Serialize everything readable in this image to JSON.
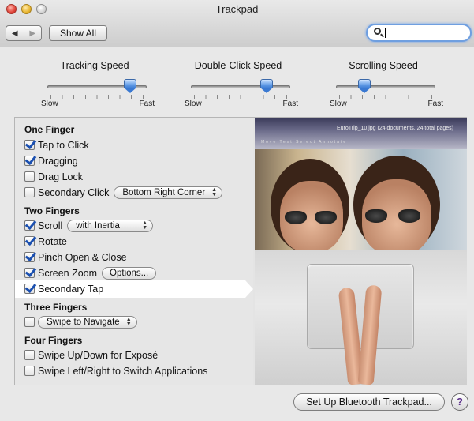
{
  "window": {
    "title": "Trackpad",
    "nav": {
      "back": "◀",
      "forward": "▶"
    },
    "show_all": "Show All",
    "search": {
      "value": "",
      "placeholder": ""
    }
  },
  "sliders": [
    {
      "title": "Tracking Speed",
      "min_label": "Slow",
      "max_label": "Fast",
      "value_fraction": 0.88
    },
    {
      "title": "Double-Click Speed",
      "min_label": "Slow",
      "max_label": "Fast",
      "value_fraction": 0.8
    },
    {
      "title": "Scrolling Speed",
      "min_label": "Slow",
      "max_label": "Fast",
      "value_fraction": 0.25
    }
  ],
  "sections": {
    "one_finger": "One Finger",
    "two_fingers": "Two Fingers",
    "three_fingers": "Three Fingers",
    "four_fingers": "Four Fingers"
  },
  "options": {
    "tap_to_click": {
      "label": "Tap to Click",
      "checked": true
    },
    "dragging": {
      "label": "Dragging",
      "checked": true
    },
    "drag_lock": {
      "label": "Drag Lock",
      "checked": false
    },
    "secondary_click": {
      "label": "Secondary Click",
      "checked": false,
      "popup": "Bottom Right Corner"
    },
    "scroll": {
      "label": "Scroll",
      "checked": true,
      "popup": "with Inertia"
    },
    "rotate": {
      "label": "Rotate",
      "checked": true
    },
    "pinch": {
      "label": "Pinch Open & Close",
      "checked": true
    },
    "screen_zoom": {
      "label": "Screen Zoom",
      "checked": true,
      "button": "Options..."
    },
    "secondary_tap": {
      "label": "Secondary Tap",
      "checked": true
    },
    "three_finger": {
      "checked": false,
      "popup": "Swipe to Navigate"
    },
    "expose": {
      "label": "Swipe Up/Down for Exposé",
      "checked": false
    },
    "switch_apps": {
      "label": "Swipe Left/Right to Switch Applications",
      "checked": false
    }
  },
  "preview": {
    "window_title": "EuroTrip_10.jpg (24 documents, 24 total pages)",
    "toolbar": "Move  Text  Select  Annotate"
  },
  "footer": {
    "bluetooth_button": "Set Up Bluetooth Trackpad...",
    "help": "?"
  }
}
